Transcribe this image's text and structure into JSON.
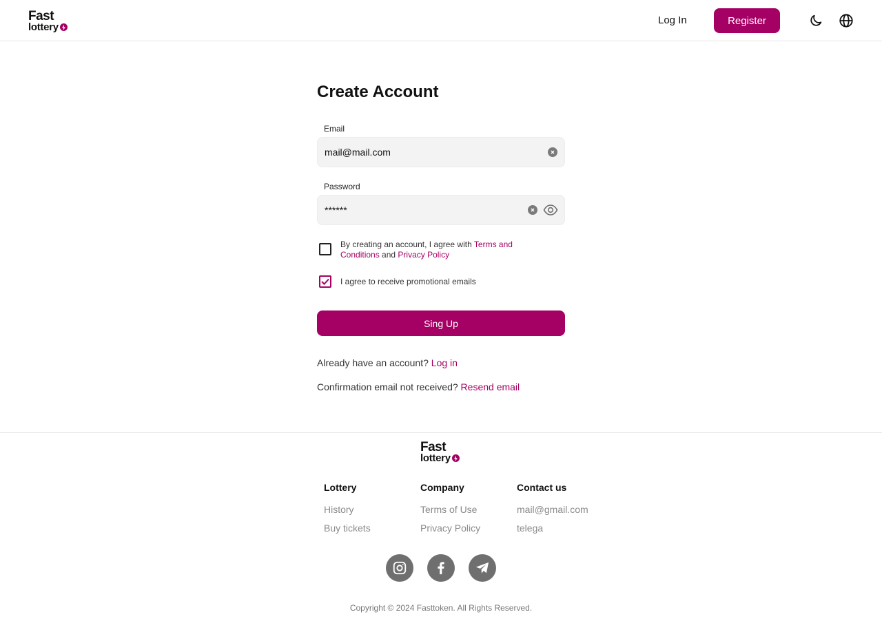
{
  "brand": {
    "line1": "Fast",
    "line2": "lottery"
  },
  "header": {
    "login_label": "Log In",
    "register_label": "Register"
  },
  "form": {
    "title": "Create Account",
    "email_label": "Email",
    "email_value": "mail@mail.com",
    "password_label": "Password",
    "password_value": "******",
    "terms_prefix": "By creating an account, I agree with ",
    "terms_link": "Terms and Conditions",
    "terms_and": " and ",
    "privacy_link": "Privacy Policy",
    "promo_label": "I agree to receive promotional emails",
    "terms_checked": false,
    "promo_checked": true,
    "signup_label": "Sing Up",
    "have_account_text": "Already have an account? ",
    "login_link": "Log in",
    "confirm_text": "Confirmation email not received? ",
    "resend_link": "Resend email"
  },
  "footer": {
    "columns": [
      {
        "heading": "Lottery",
        "items": [
          "History",
          "Buy tickets"
        ]
      },
      {
        "heading": "Company",
        "items": [
          "Terms of Use",
          "Privacy Policy"
        ]
      },
      {
        "heading": "Contact us",
        "items": [
          "mail@gmail.com",
          "telega"
        ]
      }
    ],
    "social": [
      "instagram-icon",
      "facebook-icon",
      "telegram-icon"
    ],
    "copyright": "Copyright © 2024 Fasttoken. All Rights Reserved."
  },
  "colors": {
    "accent": "#a50064",
    "field_bg": "#f3f3f3",
    "social_bg": "#6f6f6f",
    "muted_text": "#8a8a8a"
  }
}
